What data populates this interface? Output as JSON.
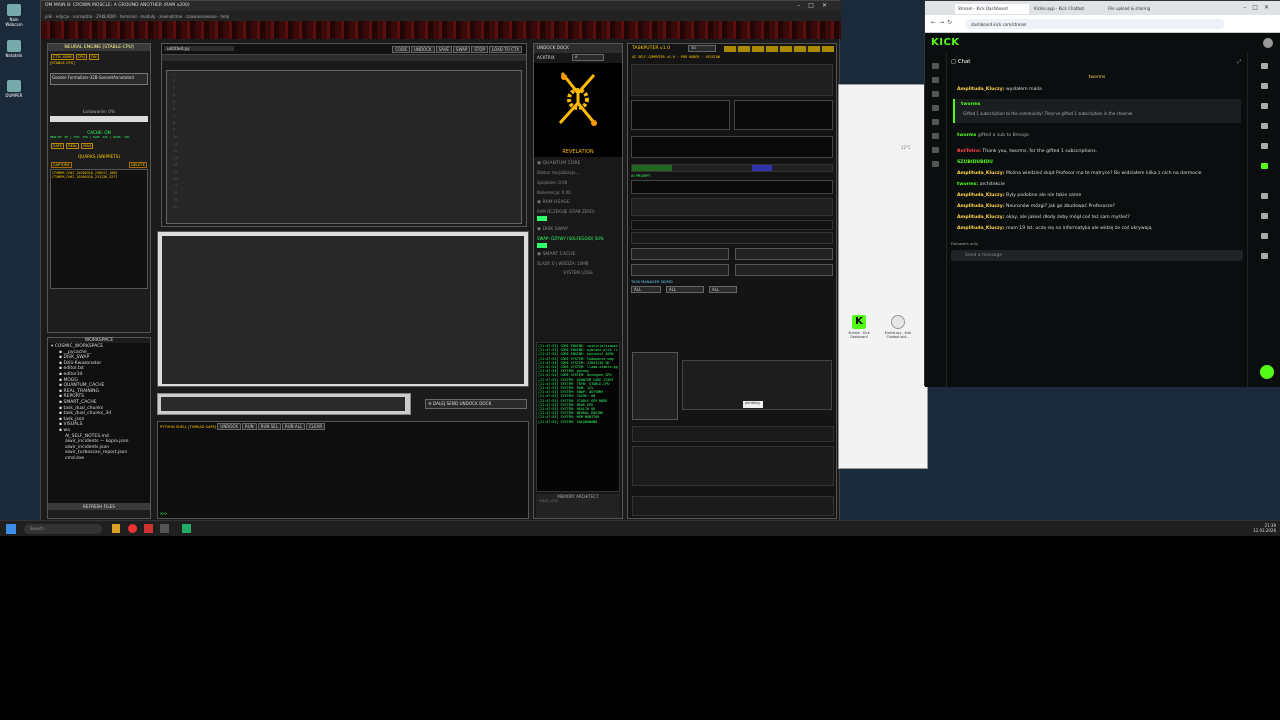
{
  "desktop": {
    "icons": [
      {
        "label": "Nain Webcam"
      },
      {
        "label": "Notatnik"
      },
      {
        "label": "DUMPER"
      }
    ]
  },
  "ide": {
    "title": "OM MAIN  B: CROWN MOSCLE: A GROUND ANOTHER  (RAM x200)",
    "menu": [
      "plik",
      "edycja",
      "narzędzia",
      "ZAKŁADKI",
      "terminal",
      "moduły",
      "zewnętrzne",
      "zaawansowane",
      "help"
    ],
    "neural": {
      "title": "NEURAL ENGINE [STABLE-CPU]",
      "badges": [
        "CTX: 4096",
        "CPU",
        "ON"
      ],
      "status": "[STABLE CPU]",
      "model": "Goedel-Formalizer-32B-SonnetAnnotated",
      "loading": "Ładowanie: 0%",
      "cache_title": "CACHE: ON",
      "cache_info": "HEALTH: OK  |  CPU: 15%  |  RAM: 12%  |  DISK: 34%",
      "modes": [
        "SAFE",
        "REAL",
        "MAX"
      ],
      "quarks_title": "QUARKS (SNIPPETS)",
      "quark_buttons": [
        "CAPTURE",
        "DELETE"
      ],
      "quarks": [
        "CTXMEM_CHAT_20260310_230517_1005",
        "CTXMEM_CHAT_20260310_231236_3277"
      ]
    },
    "workspace": {
      "title": "WORKSPACE",
      "items": [
        "COSMIC_WORKSPACE",
        "__pycache__",
        "DISK_SWAP",
        "Dzili-Kwazonator",
        "editor.txt",
        "editor3d",
        "MOGG",
        "QUANTUM_CACHE",
        "REAL_TRAINING",
        "REPORTS",
        "SMART_CACHE",
        "task_dual_chunks",
        "task_dual_chunks_3d",
        "task_json",
        "VISUALS",
        "wa",
        "AI_SELF_NOTES.md",
        "aiwir_incidents — kopia.json",
        "aiwir_incidents.json",
        "aiwir_turboscan_report.json",
        "cmd.exe"
      ],
      "refresh": "REFRESH FILES"
    },
    "editor": {
      "tab": "untitled.py",
      "buttons": [
        "CODE",
        "UNDOCK",
        "SAVE",
        "SWAP",
        "STOP",
        "LOAD TO CTX"
      ],
      "line_numbers": [
        "1",
        "2",
        "3",
        "4",
        "5",
        "6",
        "7",
        "8",
        "9",
        "10",
        "11",
        "12",
        "13",
        "14",
        "15",
        "16",
        "17",
        "18",
        "19",
        "20"
      ]
    },
    "action_bar": {
      "buttons": [
        "DALEJ",
        "SEND",
        "UNDOCK",
        "DOCK"
      ]
    },
    "shell": {
      "title": "PYTHON SHELL [THREAD SAFE]",
      "buttons": [
        "UNDOCK",
        "RUN",
        "RUN SEL",
        "RUN ALL",
        "CLEAR"
      ],
      "prompt": ">>>"
    },
    "quantum": {
      "header_buttons": [
        "UNDOCK",
        "DOCK"
      ],
      "acktrix": "ACKTRIX",
      "select": "A",
      "revelation": "REVELATION",
      "core_title": "QUANTUM CORE",
      "core_lines": [
        "Status: Inicjalizacja...",
        "Splątanie: 0.00",
        "Koherencja: 0.00"
      ],
      "ram_title": "RAM USAGE",
      "ram_sub": "RAM OCZEKUJE (STAN ZERO)",
      "swap_title": "DISK SWAP",
      "swap_sub": "SWAP: OZYWY (SOLFEGGIO) 50%",
      "cache_title": "SMART CACHE",
      "cache_sub": "ŚLADY: 0 | WIEDZA: 10MB",
      "logs_title": "SYSTEM LOGS",
      "logs": [
        "[21:47:53] CORE ENGINE: zainicjalizowano",
        "[21:47:53] CORE ENGINE: wybrano plik llama-2-7b.gguf",
        "[21:47:53] CORE ENGINE: kontekst 4096",
        "[21:47:53] CORE SYSTEM: ładowanie wag",
        "[21:47:53] CORE SYSTEM: 23041230 OK",
        "[21:47:53] CORE SYSTEM: llama-stable.gguf",
        "[21:47:53] SYSTEM: gotowy",
        "[21:47:53] CORE SYSTEM: Dostępne GPU",
        "[21:47:53] SYSTEM: QUANTUM CORE START",
        "[21:47:53] SYSTEM: TRYB: STABLE-CPU",
        "[21:47:53] SYSTEM: RAM: 12%",
        "[21:47:53] SYSTEM: SWAP: AKTYWNY",
        "[21:47:53] SYSTEM: CACHE: ON",
        "[21:47:53] SYSTEM: STABLE GPU MODE",
        "[21:47:53] SYSTEM: BRAK GPU",
        "[21:47:53] SYSTEM: HEALTH OK",
        "[21:47:53] SYSTEM: NEURAL ENGINE",
        "[21:47:53] SYSTEM: MEM MONITOR",
        "[21:47:53] SYSTEM: ZAŁADOWANO"
      ],
      "memory_title": "MEMORY ARCHITECT",
      "memory_sub": "CHAT_LOG"
    },
    "taskputer": {
      "title": "TASKPUTER v1.0",
      "select": "3D",
      "subtitle": "AI SELF-COMPUTER v1.0 · PRO KODER · SESSION",
      "prompt_label": "AI PROMPT",
      "filters": [
        "ALL",
        "ALL",
        "ALL"
      ],
      "status": "pending",
      "task_manager": "TASK MANAGER 3D/MD"
    }
  },
  "browser": {
    "tabs": [
      "Stream - Kick Dashboard",
      "Kickle.app - Kick Chatbot",
      "File upload & sharing"
    ],
    "url": "dashboard.kick.com/stream",
    "logo": "KICK",
    "chat_title": "Chat",
    "gift_banner": "tworms",
    "messages": [
      {
        "user": "Amplituda_Kluczy:",
        "text": "wysłałem maila"
      },
      {
        "user": "tworms",
        "text": ""
      },
      {
        "user": "",
        "text": "Gifted 1 subscription to the community! They've gifted 1 subscription in the channel."
      },
      {
        "user": "tworms",
        "text": "gifted a sub to Bmogo"
      },
      {
        "user": "BotTetro:",
        "text": "Thank you, tworms, for the gifted 1 subscriptions."
      },
      {
        "user": "SZUBIDUBIDU",
        "text": ""
      },
      {
        "user": "Amplituda_Kluczy:",
        "text": "Można wiedzieć skąd Profesor ma te matryce? Bo widziałem kilka z nich na darmocie"
      },
      {
        "user": "tworms:",
        "text": "architekcie"
      },
      {
        "user": "Amplituda_Kluczy:",
        "text": "Były podobne ale nie takie same"
      },
      {
        "user": "Amplituda_Kluczy:",
        "text": "Neuronów mózgi? jak go zbudować Profesorze?"
      },
      {
        "user": "Amplituda_Kluczy:",
        "text": "okay, ale jakieś dłody żeby mógł coś też sam myśleć?"
      },
      {
        "user": "Amplituda_Kluczy:",
        "text": "mam 19 lat, uczę się na informatyka ale widzę że coś ukrywają"
      }
    ],
    "followers_only": "Followers only",
    "chat_placeholder": "Send a message"
  },
  "mid_window": {
    "temp": "22°C",
    "apps": [
      "Stream - Kick Dashboard",
      "KickleLazy - Kick Chatbot and..."
    ]
  },
  "taskbar": {
    "search_placeholder": "Search",
    "time": "21:39",
    "date": "12.03.2026"
  },
  "colors": {
    "kick_green": "#53fc18",
    "chat_user": "#ffd34a"
  }
}
